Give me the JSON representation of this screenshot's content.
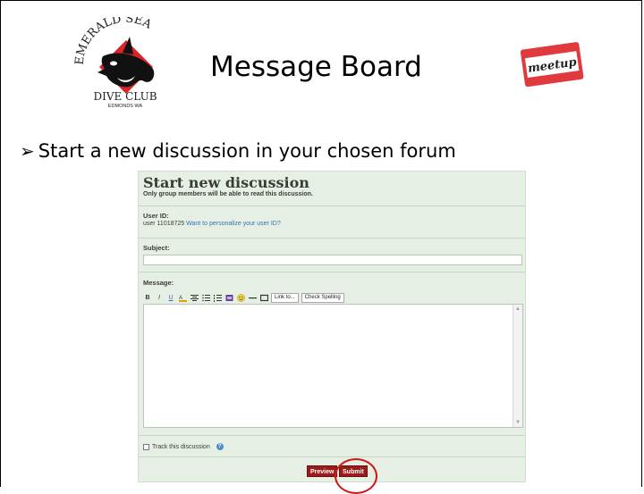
{
  "slide": {
    "title": "Message Board",
    "bullet": "Start a new discussion in your chosen forum"
  },
  "logo": {
    "arc_text": "EMERALD SEA",
    "club_text": "DIVE CLUB",
    "location_text": "EDMONDS WA"
  },
  "meetup": {
    "text": "meetup"
  },
  "form": {
    "heading": "Start new discussion",
    "subheading": "Only group members will be able to read this discussion.",
    "user_id_label": "User ID:",
    "user_id_value": "user 11018725",
    "personalize_link": "Want to personalize your user ID?",
    "subject_label": "Subject:",
    "subject_value": "",
    "message_label": "Message:",
    "message_value": "",
    "toolbar": {
      "bold": "B",
      "italic": "I",
      "underline": "U",
      "link_button": "Link to...",
      "spell_button": "Check Spelling"
    },
    "track_label": "Track this discussion",
    "help_mark": "?",
    "preview_button": "Preview",
    "submit_button": "Submit"
  },
  "colors": {
    "form_bg": "#e5efe3",
    "button_red": "#9b1a1a",
    "highlight_circle": "#d01818",
    "link_blue": "#3a6fb0"
  }
}
